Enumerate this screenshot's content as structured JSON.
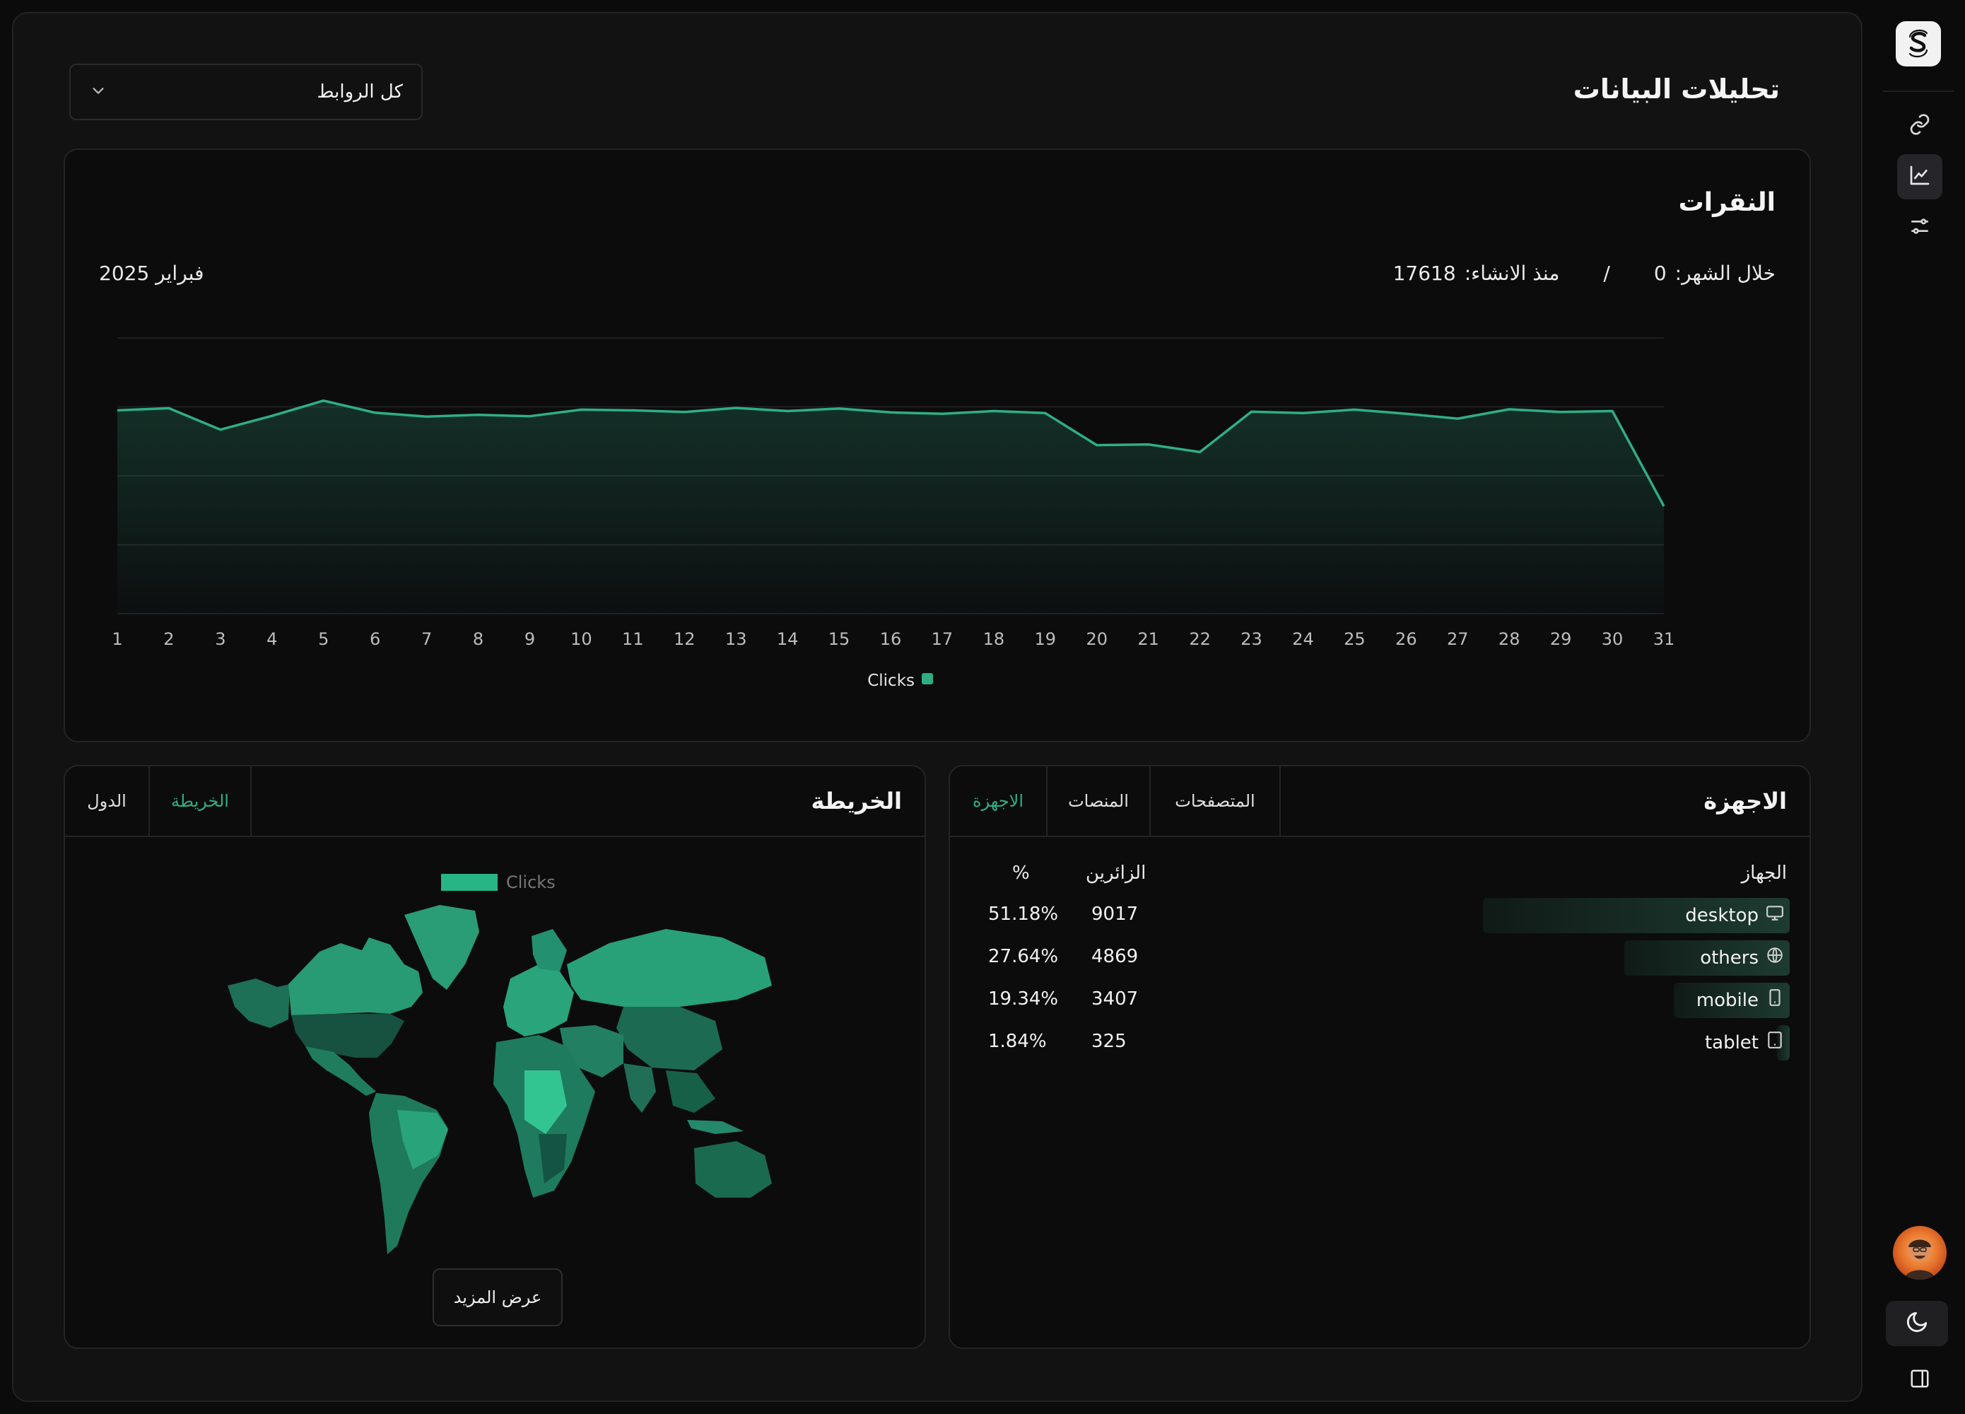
{
  "header": {
    "title": "تحليلات البيانات",
    "link_filter": "كل الروابط"
  },
  "clicks": {
    "title": "النقرات",
    "month_label": "خلال الشهر:",
    "month_value": "0",
    "separator": "/",
    "total_label": "منذ الانشاء:",
    "total_value": "17618",
    "period": "فبراير 2025"
  },
  "chart_data": {
    "type": "area",
    "x": [
      "1",
      "2",
      "3",
      "4",
      "5",
      "6",
      "7",
      "8",
      "9",
      "10",
      "11",
      "12",
      "13",
      "14",
      "15",
      "16",
      "17",
      "18",
      "19",
      "20",
      "21",
      "22",
      "23",
      "24",
      "25",
      "26",
      "27",
      "28",
      "29",
      "30",
      "31"
    ],
    "series": [
      {
        "name": "Clicks",
        "values": [
          590,
          596,
          534,
          574,
          618,
          583,
          572,
          577,
          573,
          592,
          590,
          585,
          597,
          588,
          595,
          584,
          580,
          588,
          582,
          489,
          491,
          469,
          586,
          582,
          592,
          580,
          566,
          593,
          585,
          588,
          312
        ]
      }
    ],
    "ylim": [
      0,
      800
    ],
    "grid": true,
    "legend_placement": "bottom-center",
    "color": "#2fae84"
  },
  "map": {
    "title": "الخريطة",
    "tabs": [
      "الخريطة",
      "الدول"
    ],
    "active_tab": "الخريطة",
    "legend_label": "Clicks",
    "more_button": "عرض المزيد",
    "color": "#28b585"
  },
  "devices": {
    "title": "الاجهزة",
    "tabs": [
      "المتصفحات",
      "المنصات",
      "الاجهزة"
    ],
    "active_tab": "الاجهزة",
    "columns": {
      "device": "الجهاز",
      "visitors": "الزائرين",
      "percent": "%"
    },
    "rows": [
      {
        "name": "desktop",
        "icon": "monitor-icon",
        "visitors": "9017",
        "percent": "51.18%",
        "share": 0.5118
      },
      {
        "name": "others",
        "icon": "globe-icon",
        "visitors": "4869",
        "percent": "27.64%",
        "share": 0.2764
      },
      {
        "name": "mobile",
        "icon": "smartphone-icon",
        "visitors": "3407",
        "percent": "19.34%",
        "share": 0.1934
      },
      {
        "name": "tablet",
        "icon": "tablet-icon",
        "visitors": "325",
        "percent": "1.84%",
        "share": 0.0184
      }
    ]
  }
}
